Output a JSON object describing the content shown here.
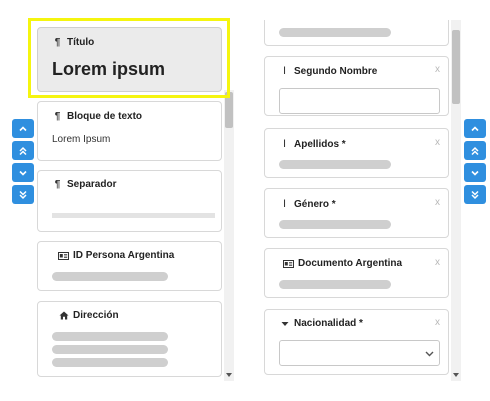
{
  "left_panel": {
    "titulo": {
      "icon": "pilcrow-icon",
      "title": "Título",
      "value": "Lorem ipsum"
    },
    "bloque": {
      "icon": "pilcrow-icon",
      "title": "Bloque de texto",
      "value": "Lorem Ipsum"
    },
    "separador": {
      "icon": "pilcrow-icon",
      "title": "Separador"
    },
    "id_persona": {
      "icon": "id-card-icon",
      "title": "ID Persona Argentina"
    },
    "direccion": {
      "icon": "home-icon",
      "title": "Dirección"
    }
  },
  "right_panel": {
    "segundo_nombre": {
      "icon": "text-cursor-icon",
      "title": "Segundo Nombre",
      "remove": "x"
    },
    "apellidos": {
      "icon": "text-cursor-icon",
      "title": "Apellidos *",
      "remove": "x"
    },
    "genero": {
      "icon": "text-cursor-icon",
      "title": "Género *",
      "remove": "x"
    },
    "documento": {
      "icon": "id-card-icon",
      "title": "Documento Argentina",
      "remove": "x"
    },
    "nacionalidad": {
      "icon": "caret-down-icon",
      "title": "Nacionalidad *",
      "remove": "x"
    }
  },
  "nav_buttons": [
    "chevron-up-icon",
    "double-chevron-up-icon",
    "chevron-down-icon",
    "double-chevron-down-icon"
  ],
  "colors": {
    "accent": "#2f8fdf",
    "selection": "#f5f50f",
    "skeleton": "#cfcfcf"
  }
}
